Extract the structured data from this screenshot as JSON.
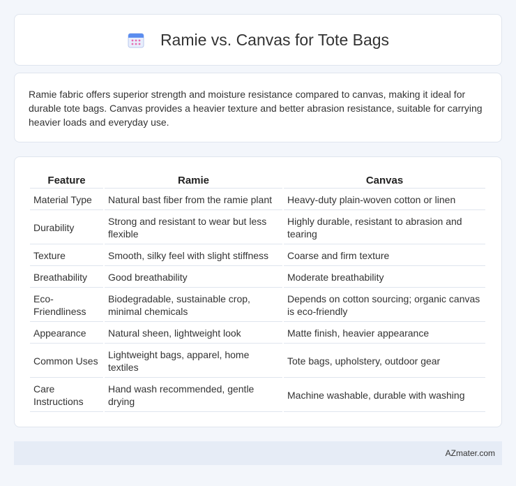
{
  "header": {
    "title": "Ramie vs. Canvas for Tote Bags",
    "icon": "calendar-icon"
  },
  "summary": {
    "text": "Ramie fabric offers superior strength and moisture resistance compared to canvas, making it ideal for durable tote bags. Canvas provides a heavier texture and better abrasion resistance, suitable for carrying heavier loads and everyday use."
  },
  "table": {
    "headers": [
      "Feature",
      "Ramie",
      "Canvas"
    ],
    "rows": [
      [
        "Material Type",
        "Natural bast fiber from the ramie plant",
        "Heavy-duty plain-woven cotton or linen"
      ],
      [
        "Durability",
        "Strong and resistant to wear but less flexible",
        "Highly durable, resistant to abrasion and tearing"
      ],
      [
        "Texture",
        "Smooth, silky feel with slight stiffness",
        "Coarse and firm texture"
      ],
      [
        "Breathability",
        "Good breathability",
        "Moderate breathability"
      ],
      [
        "Eco-Friendliness",
        "Biodegradable, sustainable crop, minimal chemicals",
        "Depends on cotton sourcing; organic canvas is eco-friendly"
      ],
      [
        "Appearance",
        "Natural sheen, lightweight look",
        "Matte finish, heavier appearance"
      ],
      [
        "Common Uses",
        "Lightweight bags, apparel, home textiles",
        "Tote bags, upholstery, outdoor gear"
      ],
      [
        "Care Instructions",
        "Hand wash recommended, gentle drying",
        "Machine washable, durable with washing"
      ]
    ]
  },
  "footer": {
    "brand": "AZmater.com"
  },
  "colors": {
    "page_bg": "#f3f6fb",
    "card_bg": "#ffffff",
    "footer_bg": "#e6ecf6",
    "icon_blue": "#5b8def",
    "icon_pink": "#e66bb0"
  }
}
